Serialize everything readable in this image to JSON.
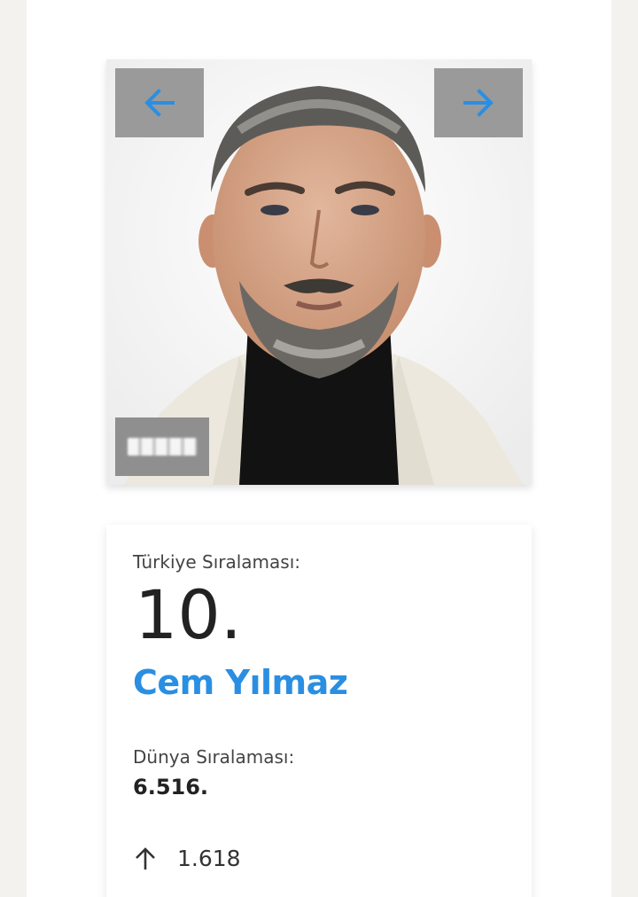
{
  "profile": {
    "photo_alt": "Cem Yılmaz",
    "nav": {
      "prev_icon": "arrow-left-icon",
      "next_icon": "arrow-right-icon"
    },
    "logo_badge": "watermark-logo"
  },
  "ranking": {
    "turkey_label": "Türkiye Sıralaması:",
    "turkey_rank": "10.",
    "name": "Cem Yılmaz",
    "world_label": "Dünya Sıralaması:",
    "world_rank": "6.516.",
    "change_icon": "arrow-up-icon",
    "change_value": "1.618"
  },
  "colors": {
    "accent": "#2a8fe2",
    "nav_button_bg": "#9a9a9a",
    "page_bg": "#f3f2ee"
  }
}
